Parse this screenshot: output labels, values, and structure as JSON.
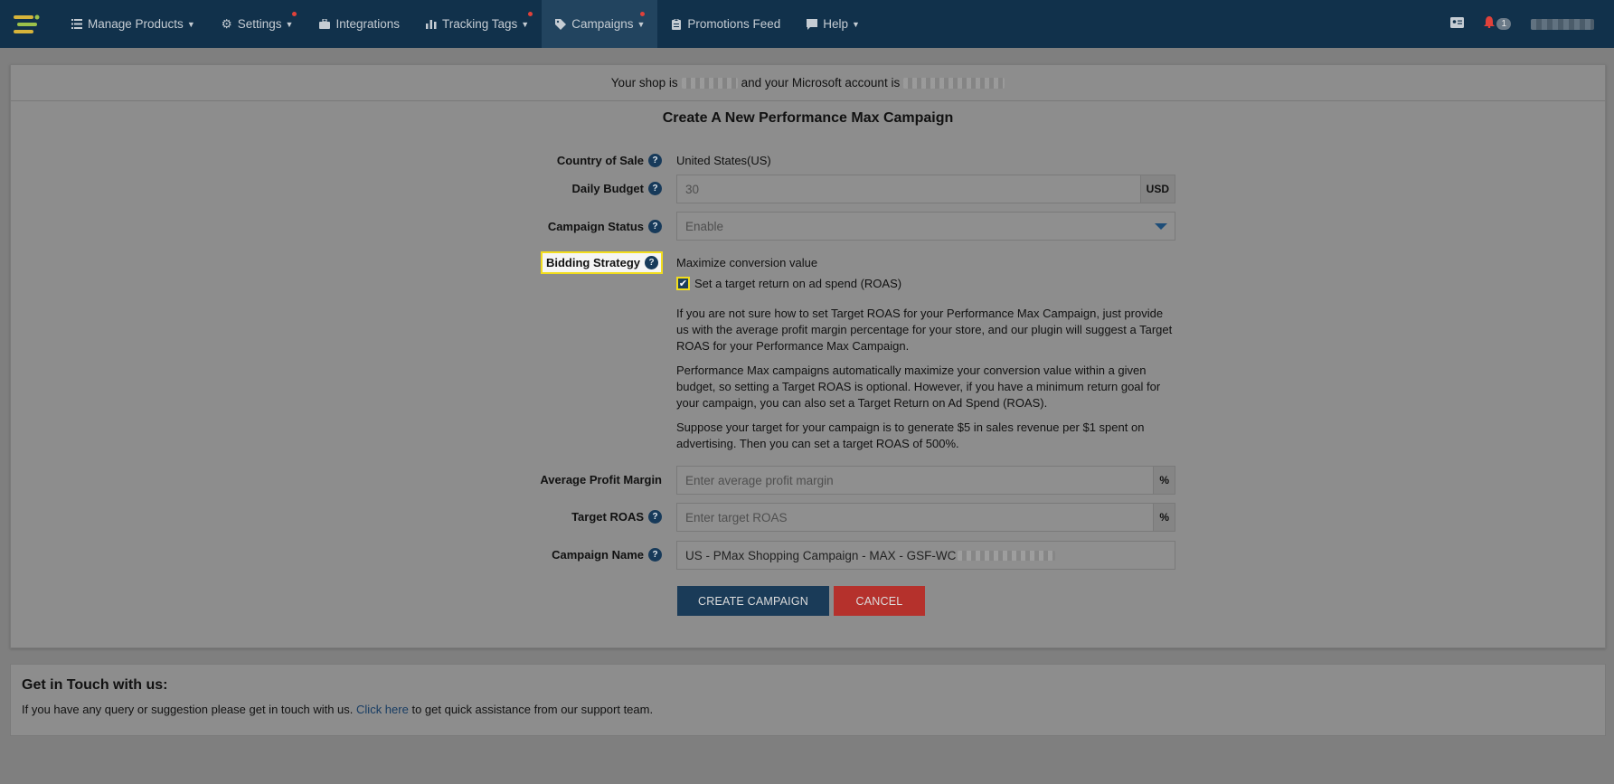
{
  "nav": {
    "items": [
      {
        "label": "Manage Products",
        "icon": "list-icon",
        "caret": true,
        "dot": false
      },
      {
        "label": "Settings",
        "icon": "gear-icon",
        "caret": true,
        "dot": true
      },
      {
        "label": "Integrations",
        "icon": "briefcase-icon",
        "caret": false,
        "dot": false
      },
      {
        "label": "Tracking Tags",
        "icon": "bar-chart-icon",
        "caret": true,
        "dot": true
      },
      {
        "label": "Campaigns",
        "icon": "tag-icon",
        "caret": true,
        "dot": true
      },
      {
        "label": "Promotions Feed",
        "icon": "clipboard-icon",
        "caret": false,
        "dot": false
      },
      {
        "label": "Help",
        "icon": "comment-icon",
        "caret": true,
        "dot": false
      }
    ],
    "notification_count": "1",
    "colors": {
      "navbar": "#11314b",
      "accent_dot": "#e0413a"
    }
  },
  "shop": {
    "prefix": "Your shop is",
    "middle": "and your Microsoft account is"
  },
  "form": {
    "title": "Create A New Performance Max Campaign",
    "country": {
      "label": "Country of Sale",
      "value": "United States(US)"
    },
    "budget": {
      "label": "Daily Budget",
      "value": "30",
      "unit": "USD"
    },
    "status": {
      "label": "Campaign Status",
      "value": "Enable"
    },
    "bidding": {
      "label": "Bidding Strategy",
      "value": "Maximize conversion value",
      "checkbox_label": "Set a target return on ad spend (ROAS)",
      "checked": true,
      "para1": "If you are not sure how to set Target ROAS for your Performance Max Campaign, just provide us with the average profit margin percentage for your store, and our plugin will suggest a Target ROAS for your Performance Max Campaign.",
      "para2": "Performance Max campaigns automatically maximize your conversion value within a given budget, so setting a Target ROAS is optional. However, if you have a minimum return goal for your campaign, you can also set a Target Return on Ad Spend (ROAS).",
      "para3": "Suppose your target for your campaign is to generate $5 in sales revenue per $1 spent on advertising. Then you can set a target ROAS of 500%."
    },
    "margin": {
      "label": "Average Profit Margin",
      "placeholder": "Enter average profit margin",
      "unit": "%"
    },
    "roas": {
      "label": "Target ROAS",
      "placeholder": "Enter target ROAS",
      "unit": "%"
    },
    "name": {
      "label": "Campaign Name",
      "value": "US - PMax Shopping Campaign - MAX - GSF-WC"
    },
    "create_label": "CREATE CAMPAIGN",
    "cancel_label": "CANCEL"
  },
  "contact": {
    "title": "Get in Touch with us:",
    "text_before": "If you have any query or suggestion please get in touch with us.",
    "link": "Click here",
    "text_after": "to get quick assistance from our support team."
  }
}
